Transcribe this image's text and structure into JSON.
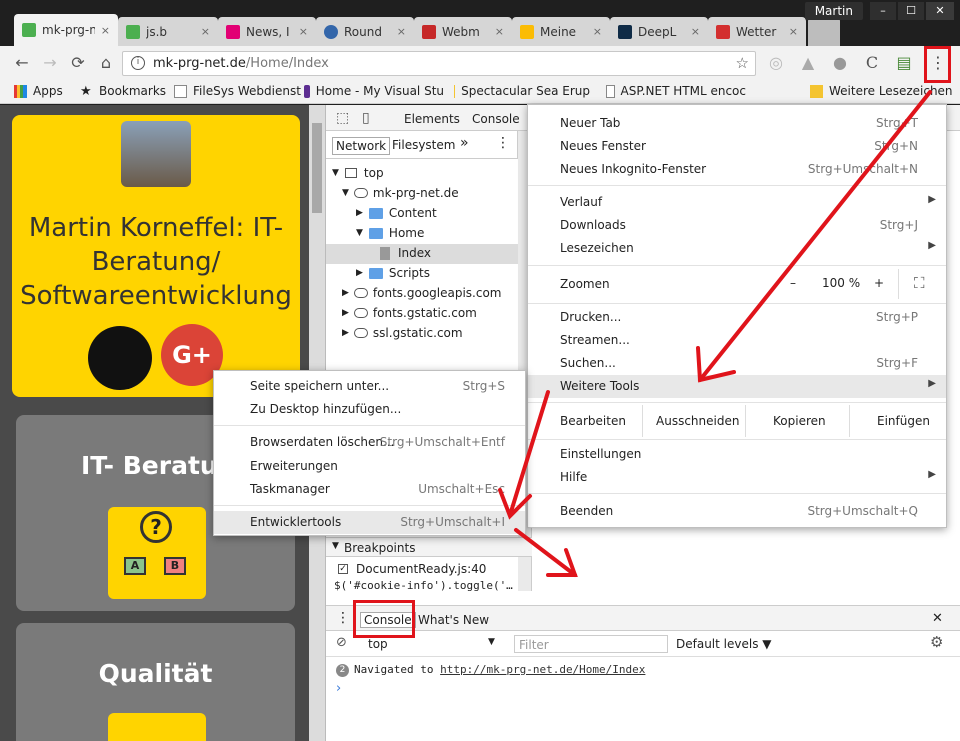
{
  "titlebar": {
    "user": "Martin",
    "controls": {
      "minimize": "–",
      "maximize": "☐",
      "close": "✕"
    },
    "tabs": [
      {
        "label": "mk-prg-n",
        "active": true,
        "color": "#4caf50"
      },
      {
        "label": "js.b",
        "active": false,
        "color": "#4caf50"
      },
      {
        "label": "News, I",
        "active": false,
        "color": "#e20074"
      },
      {
        "label": "Round",
        "active": false,
        "color": "#3366aa"
      },
      {
        "label": "Webm",
        "active": false,
        "color": "#c62828"
      },
      {
        "label": "Meine",
        "active": false,
        "color": "#fbbc04"
      },
      {
        "label": "DeepL",
        "active": false,
        "color": "#0f2b46"
      },
      {
        "label": "Wetter",
        "active": false,
        "color": "#d32f2f"
      }
    ],
    "tab_close": "×"
  },
  "toolbar": {
    "back": "←",
    "forward": "→",
    "reload": "⟳",
    "home": "⌂",
    "info_icon": "i",
    "url_host": "mk-prg-net.de",
    "url_path": "/Home/Index",
    "star": "☆",
    "menu_dots": "⋮"
  },
  "bookmarks": [
    {
      "label": "Apps"
    },
    {
      "label": "Bookmarks"
    },
    {
      "label": "FileSys Webdienst"
    },
    {
      "label": "Home - My Visual Stu"
    },
    {
      "label": "Spectacular Sea Erup"
    },
    {
      "label": "ASP.NET HTML encoc"
    },
    {
      "label": "Weitere Lesezeichen"
    }
  ],
  "webpage": {
    "title": "Martin Korneffel: IT-Beratung/ Softwareentwicklung",
    "card2_title": "IT- Beratur",
    "card3_title": "Qualität",
    "badge_a": "A",
    "badge_b": "B",
    "qmark": "?",
    "gplus": "G+"
  },
  "devtools": {
    "tabs": {
      "elements": "Elements",
      "console": "Console"
    },
    "subtabs": {
      "network": "Network",
      "filesystem": "Filesystem",
      "more": "»",
      "dots": "⋮"
    },
    "tree": {
      "top": "top",
      "site": "mk-prg-net.de",
      "content": "Content",
      "home": "Home",
      "index": "Index",
      "scripts": "Scripts",
      "f1": "fonts.googleapis.com",
      "f2": "fonts.gstatic.com",
      "f3": "ssl.gstatic.com"
    },
    "breakpoints_label": "Breakpoints",
    "bp_file": "DocumentReady.js:40",
    "bp_code": "$('#cookie-info').toggle('…",
    "drawer": {
      "tab_console": "Console",
      "tab_whatsnew": "What's New",
      "close": "✕",
      "context": "top",
      "filter_placeholder": "Filter",
      "levels": "Default levels ▼",
      "count": "2",
      "msg_prefix": "Navigated to",
      "msg_link": "http://mk-prg-net.de/Home/Index",
      "prompt": "›"
    }
  },
  "chrome_menu": {
    "items": [
      {
        "label": "Neuer Tab",
        "shortcut": "Strg+T"
      },
      {
        "label": "Neues Fenster",
        "shortcut": "Strg+N"
      },
      {
        "label": "Neues Inkognito-Fenster",
        "shortcut": "Strg+Umschalt+N"
      },
      {
        "label": "Verlauf",
        "shortcut": "",
        "arrow": "▶"
      },
      {
        "label": "Downloads",
        "shortcut": "Strg+J"
      },
      {
        "label": "Lesezeichen",
        "shortcut": "",
        "arrow": "▶"
      },
      {
        "label": "Zoomen"
      },
      {
        "label": "Drucken...",
        "shortcut": "Strg+P"
      },
      {
        "label": "Streamen..."
      },
      {
        "label": "Suchen...",
        "shortcut": "Strg+F"
      },
      {
        "label": "Weitere Tools",
        "arrow": "▶"
      },
      {
        "label": "Bearbeiten"
      },
      {
        "label": "Einstellungen"
      },
      {
        "label": "Hilfe",
        "arrow": "▶"
      },
      {
        "label": "Beenden",
        "shortcut": "Strg+Umschalt+Q"
      }
    ],
    "zoom": {
      "minus": "–",
      "value": "100 %",
      "plus": "+",
      "fullscreen": "⛶"
    },
    "edit": {
      "cut": "Ausschneiden",
      "copy": "Kopieren",
      "paste": "Einfügen"
    }
  },
  "submenu": {
    "items": [
      {
        "label": "Seite speichern unter...",
        "shortcut": "Strg+S"
      },
      {
        "label": "Zu Desktop hinzufügen..."
      },
      {
        "label": "Browserdaten löschen...",
        "shortcut": "Strg+Umschalt+Entf"
      },
      {
        "label": "Erweiterungen"
      },
      {
        "label": "Taskmanager",
        "shortcut": "Umschalt+Esc"
      },
      {
        "label": "Entwicklertools",
        "shortcut": "Strg+Umschalt+I"
      }
    ]
  },
  "colors": {
    "annotation": "#e0141b",
    "card_yellow": "#ffd400",
    "card_gray": "#7a7a7a"
  }
}
